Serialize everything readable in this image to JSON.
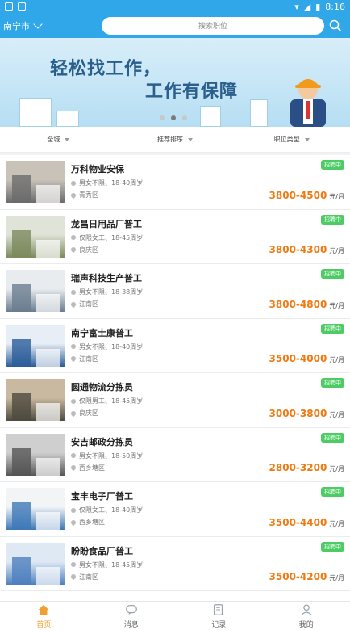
{
  "status": {
    "time": "8:16"
  },
  "header": {
    "city": "南宁市",
    "search_placeholder": "搜索职位"
  },
  "banner": {
    "line1": "轻松找工作，",
    "line2": "工作有保障"
  },
  "filters": [
    "全城",
    "推荐排序",
    "职位类型"
  ],
  "jobs": [
    {
      "title": "万科物业安保",
      "req": "男女不限、18-40周岁",
      "area": "青秀区",
      "salary": "3800-4500",
      "unit": "元/月",
      "badge": "招聘中"
    },
    {
      "title": "龙昌日用品厂普工",
      "req": "仅限女工、18-45周岁",
      "area": "良庆区",
      "salary": "3800-4300",
      "unit": "元/月",
      "badge": "招聘中"
    },
    {
      "title": "瑞声科技生产普工",
      "req": "男女不限、18-38周岁",
      "area": "江南区",
      "salary": "3800-4800",
      "unit": "元/月",
      "badge": "招聘中"
    },
    {
      "title": "南宁富士康普工",
      "req": "男女不限、18-40周岁",
      "area": "江南区",
      "salary": "3500-4000",
      "unit": "元/月",
      "badge": "招聘中"
    },
    {
      "title": "圆通物流分拣员",
      "req": "仅限男工、18-45周岁",
      "area": "良庆区",
      "salary": "3000-3800",
      "unit": "元/月",
      "badge": "招聘中"
    },
    {
      "title": "安吉邮政分拣员",
      "req": "男女不限、18-50周岁",
      "area": "西乡塘区",
      "salary": "2800-3200",
      "unit": "元/月",
      "badge": "招聘中"
    },
    {
      "title": "宝丰电子厂普工",
      "req": "仅限女工、18-40周岁",
      "area": "西乡塘区",
      "salary": "3500-4400",
      "unit": "元/月",
      "badge": "招聘中"
    },
    {
      "title": "盼盼食品厂普工",
      "req": "男女不限、18-45周岁",
      "area": "江南区",
      "salary": "3500-4200",
      "unit": "元/月",
      "badge": "招聘中"
    }
  ],
  "tabs": [
    {
      "label": "首页",
      "icon": "home-icon",
      "active": true
    },
    {
      "label": "消息",
      "icon": "message-icon",
      "active": false
    },
    {
      "label": "记录",
      "icon": "record-icon",
      "active": false
    },
    {
      "label": "我的",
      "icon": "user-icon",
      "active": false
    }
  ],
  "colors": {
    "primary": "#2fa7e8",
    "salary": "#ee7a12",
    "badge": "#4ccc63",
    "tab_active": "#f0a030"
  }
}
